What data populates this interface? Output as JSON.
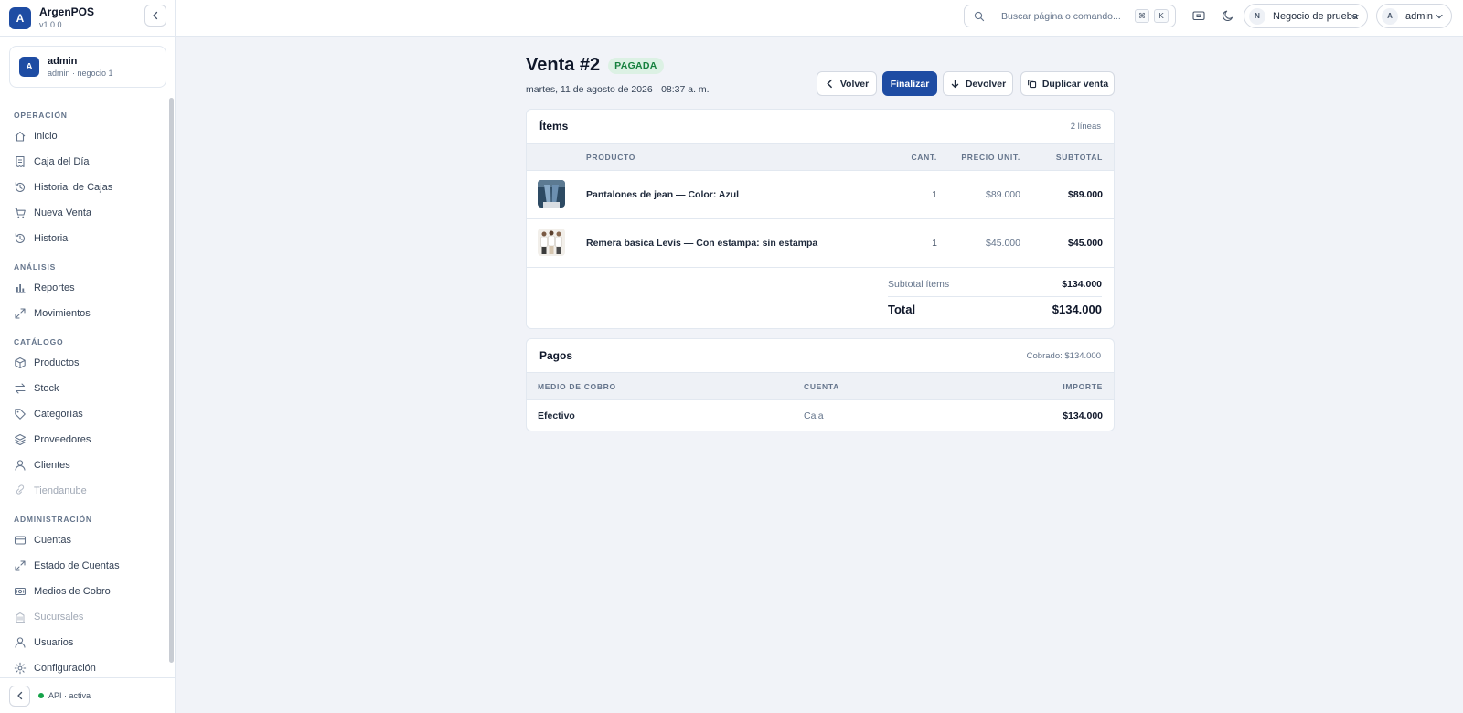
{
  "app": {
    "name": "ArgenPOS",
    "version": "v1.0.0",
    "logo_letter": "A"
  },
  "user_card": {
    "avatar": "A",
    "name": "admin",
    "subtitle": "admin · negocio 1"
  },
  "nav": {
    "sections": [
      {
        "label": "OPERACIÓN",
        "items": [
          {
            "label": "Inicio",
            "icon": "home-icon",
            "disabled": false
          },
          {
            "label": "Caja del Día",
            "icon": "receipt-icon",
            "disabled": false
          },
          {
            "label": "Historial de Cajas",
            "icon": "history-icon",
            "disabled": false
          },
          {
            "label": "Nueva Venta",
            "icon": "cart-icon",
            "disabled": false
          },
          {
            "label": "Historial",
            "icon": "history-icon",
            "disabled": false
          }
        ]
      },
      {
        "label": "ANÁLISIS",
        "items": [
          {
            "label": "Reportes",
            "icon": "bar-chart-icon",
            "disabled": false
          },
          {
            "label": "Movimientos",
            "icon": "arrows-icon",
            "disabled": false
          }
        ]
      },
      {
        "label": "CATÁLOGO",
        "items": [
          {
            "label": "Productos",
            "icon": "box-icon",
            "disabled": false
          },
          {
            "label": "Stock",
            "icon": "swap-icon",
            "disabled": false
          },
          {
            "label": "Categorías",
            "icon": "tag-icon",
            "disabled": false
          },
          {
            "label": "Proveedores",
            "icon": "layers-icon",
            "disabled": false
          },
          {
            "label": "Clientes",
            "icon": "user-icon",
            "disabled": false
          },
          {
            "label": "Tiendanube",
            "icon": "link-icon",
            "disabled": true
          }
        ]
      },
      {
        "label": "ADMINISTRACIÓN",
        "items": [
          {
            "label": "Cuentas",
            "icon": "card-icon",
            "disabled": false
          },
          {
            "label": "Estado de Cuentas",
            "icon": "arrows-icon",
            "disabled": false
          },
          {
            "label": "Medios de Cobro",
            "icon": "cash-icon",
            "disabled": false
          },
          {
            "label": "Sucursales",
            "icon": "building-icon",
            "disabled": true
          },
          {
            "label": "Usuarios",
            "icon": "user-icon",
            "disabled": false
          },
          {
            "label": "Configuración",
            "icon": "gear-icon",
            "disabled": false
          }
        ]
      }
    ]
  },
  "footer": {
    "api_status": "API · activa",
    "status_color": "#16a34a"
  },
  "topbar": {
    "search_placeholder": "Buscar página o comando...",
    "kbd_cmd": "⌘",
    "kbd_key": "K",
    "business": {
      "avatar": "N",
      "label": "Negocio de prueba"
    },
    "user": {
      "avatar": "A",
      "label": "admin"
    }
  },
  "sale": {
    "title": "Venta #2",
    "status": "PAGADA",
    "date": "martes, 11 de agosto de 2026 · 08:37 a. m.",
    "buttons": {
      "back": "Volver",
      "finish": "Finalizar",
      "refund": "Devolver",
      "duplicate": "Duplicar venta"
    }
  },
  "items_card": {
    "title": "Ítems",
    "meta": "2 líneas",
    "columns": {
      "product": "PRODUCTO",
      "qty": "CANT.",
      "unit_price": "PRECIO UNIT.",
      "subtotal": "SUBTOTAL"
    },
    "rows": [
      {
        "product": "Pantalones de jean — Color: Azul",
        "qty": "1",
        "unit_price": "$89.000",
        "subtotal": "$89.000",
        "thumb": "jeans"
      },
      {
        "product": "Remera basica Levis — Con estampa: sin estampa",
        "qty": "1",
        "unit_price": "$45.000",
        "subtotal": "$45.000",
        "thumb": "tshirts"
      }
    ],
    "subtotal_label": "Subtotal ítems",
    "subtotal_value": "$134.000",
    "total_label": "Total",
    "total_value": "$134.000"
  },
  "payments_card": {
    "title": "Pagos",
    "meta": "Cobrado: $134.000",
    "columns": {
      "method": "MEDIO DE COBRO",
      "account": "CUENTA",
      "amount": "IMPORTE"
    },
    "rows": [
      {
        "method": "Efectivo",
        "account": "Caja",
        "amount": "$134.000"
      }
    ]
  },
  "colors": {
    "accent": "#1e4ca3",
    "success_bg": "#dcf1e4",
    "success_text": "#15803d",
    "background": "#f1f3f8"
  }
}
